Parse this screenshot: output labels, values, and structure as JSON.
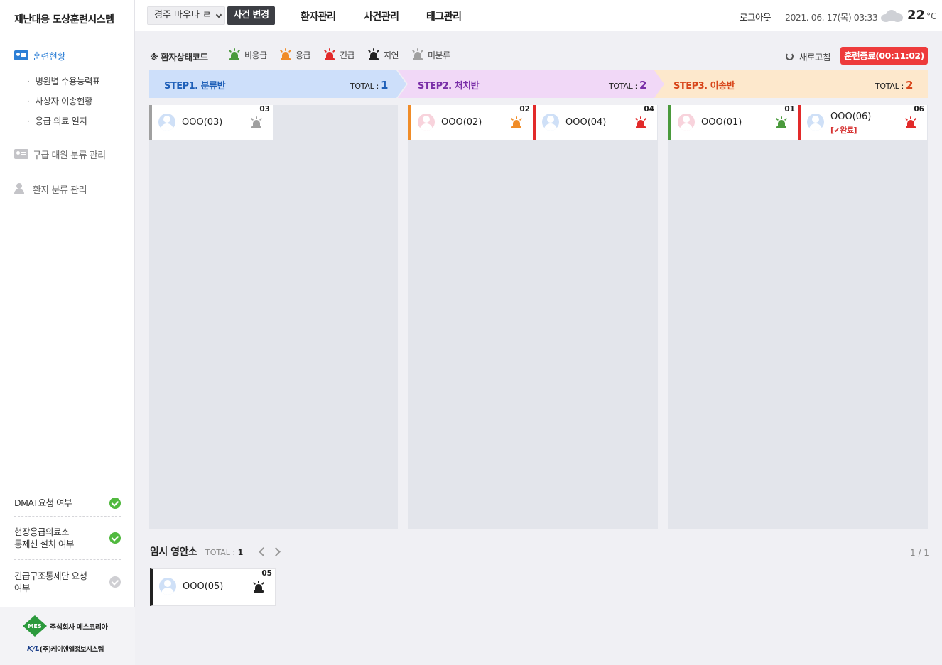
{
  "sidebar": {
    "brand": "재난대응 도상훈련시스템",
    "menu": [
      {
        "label": "훈련현황",
        "active": true
      },
      {
        "label": "구급 대원 분류 관리",
        "active": false
      },
      {
        "label": "환자 분류 관리",
        "active": false
      }
    ],
    "submenu": [
      "병원별 수용능력표",
      "사상자 이송현황",
      "응급 의료 일지"
    ],
    "checks": [
      {
        "label_lines": [
          "DMAT요청 여부"
        ],
        "state": "on"
      },
      {
        "label_lines": [
          "현장응급의료소",
          "통제선 설치 여부"
        ],
        "state": "on"
      },
      {
        "label_lines": [
          "긴급구조통제단 요청",
          "여부"
        ],
        "state": "off"
      }
    ],
    "logos": {
      "company1_mark": "MES",
      "company1": "주식회사 메스코리아",
      "company2_mark": "K/L",
      "company2": "(주)케이앤엘정보시스템"
    }
  },
  "topbar": {
    "incident_value": "경주 마우나 ㄹ",
    "change_label": "사건 변경",
    "nav": [
      "환자관리",
      "사건관리",
      "태그관리"
    ],
    "logout": "로그아웃",
    "datetime": "2021. 06. 17(목) 03:33",
    "weather_icon": "cloud-icon",
    "temperature": "22",
    "temp_unit": "°C"
  },
  "legend": {
    "title": "※ 환자상태코드",
    "items": [
      {
        "label": "비응급",
        "color": "#4a9a3c"
      },
      {
        "label": "응급",
        "color": "#f08c28"
      },
      {
        "label": "긴급",
        "color": "#e22a2a"
      },
      {
        "label": "지연",
        "color": "#222222"
      },
      {
        "label": "미분류",
        "color": "#a0a0a0"
      }
    ]
  },
  "actions": {
    "refresh": "새로고침",
    "end_training": "훈련종료(00:11:02)"
  },
  "total_label": "TOTAL :",
  "steps": [
    {
      "name": "STEP1. 분류반",
      "total": "1",
      "color": "#1e5fb8",
      "bg": "#cddffa",
      "patients": [
        {
          "id": "03",
          "name": "OOO(03)",
          "gender": "male",
          "status_color": "#a0a0a0",
          "done": ""
        }
      ]
    },
    {
      "name": "STEP2. 처치반",
      "total": "2",
      "color": "#7a2fa8",
      "bg": "#f1d8f7",
      "patients": [
        {
          "id": "02",
          "name": "OOO(02)",
          "gender": "female",
          "status_color": "#f08c28",
          "done": ""
        },
        {
          "id": "04",
          "name": "OOO(04)",
          "gender": "male",
          "status_color": "#e22a2a",
          "done": ""
        }
      ]
    },
    {
      "name": "STEP3. 이송반",
      "total": "2",
      "color": "#d8461b",
      "bg": "#fde8cc",
      "patients": [
        {
          "id": "01",
          "name": "OOO(01)",
          "gender": "female",
          "status_color": "#4a9a3c",
          "done": ""
        },
        {
          "id": "06",
          "name": "OOO(06)",
          "gender": "male",
          "status_color": "#e22a2a",
          "done": "[✔완료]"
        }
      ]
    }
  ],
  "temporary": {
    "title": "임시 영안소",
    "total": "1",
    "pager": "1 / 1",
    "patients": [
      {
        "id": "05",
        "name": "OOO(05)",
        "gender": "male",
        "status_color": "#222222"
      }
    ]
  }
}
